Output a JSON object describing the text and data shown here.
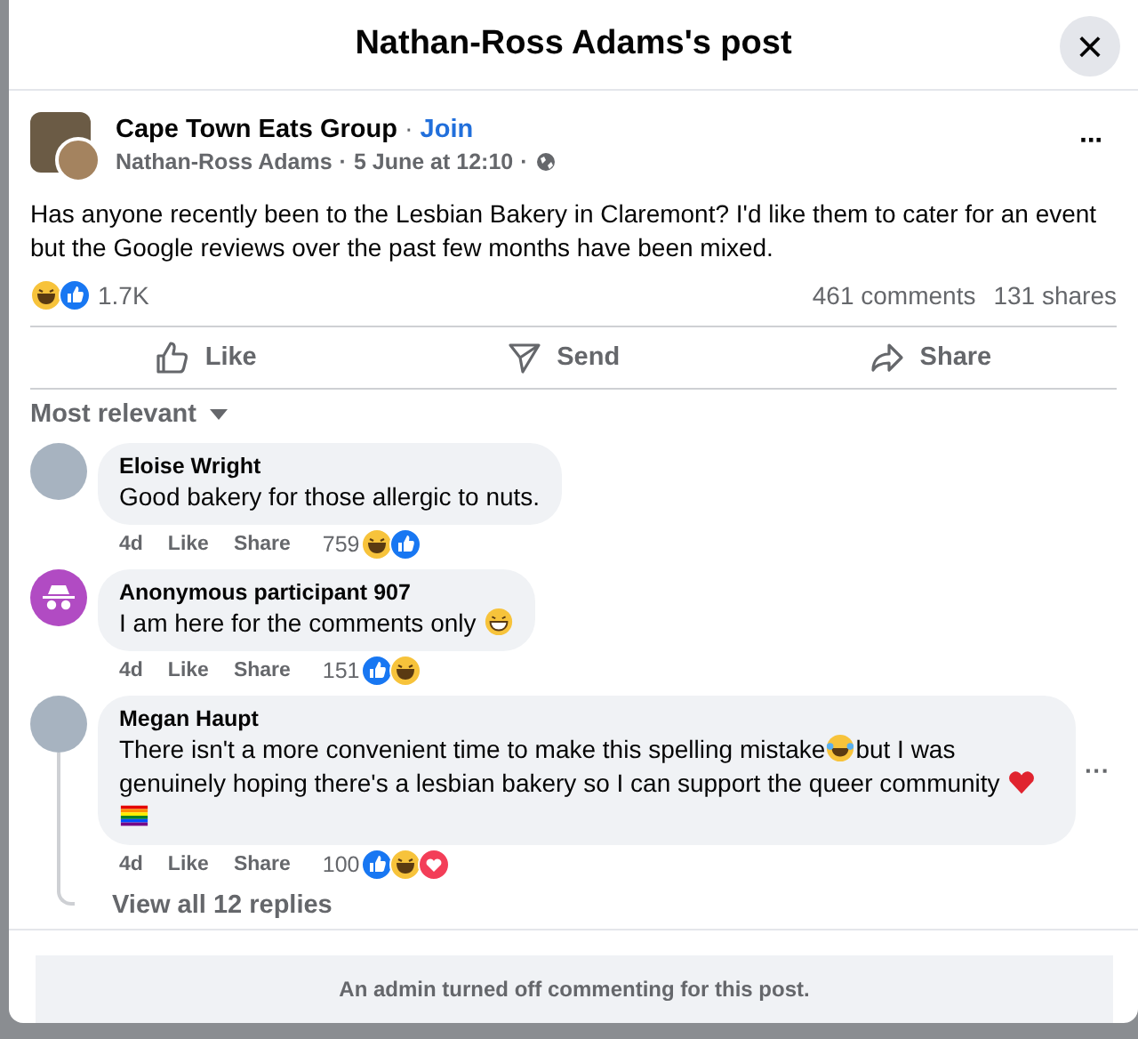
{
  "dialog": {
    "title": "Nathan-Ross Adams's post",
    "close": "×"
  },
  "post": {
    "group": "Cape Town Eats Group",
    "separator": "·",
    "join": "Join",
    "author": "Nathan-Ross Adams",
    "time": "5 June at 12:10",
    "more": "···",
    "text": "Has anyone recently been to the Lesbian Bakery in Claremont? I'd like them to cater for an event but the Google reviews over the past few months have been mixed.",
    "reactions": [
      {
        "kind": "haha"
      },
      {
        "kind": "like"
      }
    ],
    "reaction_count": "1.7K",
    "comments_count": "461 comments",
    "shares_count": "131 shares"
  },
  "actions": [
    {
      "kind": "like",
      "label": "Like"
    },
    {
      "kind": "send",
      "label": "Send"
    },
    {
      "kind": "share",
      "label": "Share"
    }
  ],
  "sort": {
    "label": "Most relevant"
  },
  "comments": [
    {
      "avatar": {
        "kind": "photo"
      },
      "name": "Eloise Wright",
      "parts": [
        {
          "kind": "text",
          "text": "Good bakery for those allergic to nuts."
        }
      ],
      "time": "4d",
      "like": "Like",
      "share": "Share",
      "count": "759",
      "reactions": [
        {
          "kind": "haha"
        },
        {
          "kind": "like"
        }
      ]
    },
    {
      "avatar": {
        "kind": "anonymous"
      },
      "name": "Anonymous participant 907",
      "parts": [
        {
          "kind": "text",
          "text": "I am here for the comments only "
        },
        {
          "kind": "grin"
        }
      ],
      "time": "4d",
      "like": "Like",
      "share": "Share",
      "count": "151",
      "reactions": [
        {
          "kind": "like"
        },
        {
          "kind": "haha"
        }
      ]
    },
    {
      "avatar": {
        "kind": "photo"
      },
      "name": "Megan Haupt",
      "parts": [
        {
          "kind": "text",
          "text": "There isn't a more convenient time to make this spelling mistake"
        },
        {
          "kind": "tears"
        },
        {
          "kind": "text",
          "text": "but I was genuinely hoping there's a lesbian bakery so I can support the queer community "
        },
        {
          "kind": "heart"
        },
        {
          "kind": "flag"
        }
      ],
      "time": "4d",
      "like": "Like",
      "share": "Share",
      "count": "100",
      "reactions": [
        {
          "kind": "like"
        },
        {
          "kind": "haha"
        },
        {
          "kind": "love"
        }
      ],
      "more": "···",
      "replies": "View all 12 replies"
    }
  ],
  "notice": "An admin turned off commenting for this post."
}
